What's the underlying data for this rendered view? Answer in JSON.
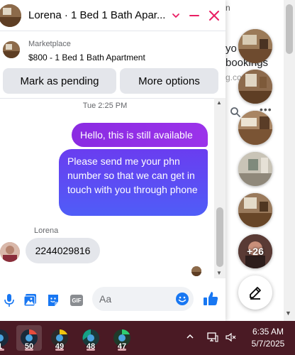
{
  "colors": {
    "accent": "#e91e63",
    "outgoing_bubble": "#7b3ff2",
    "incoming_bubble": "#e4e6eb",
    "action_button": "#e4e6eb",
    "link_blue": "#1877f2",
    "taskbar": "#4a1a24"
  },
  "background_page": {
    "fragments": [
      "n",
      "yo",
      "bookings",
      "g.co"
    ]
  },
  "chat_window": {
    "header": {
      "title": "Lorena · 1 Bed 1 Bath Apar...",
      "icons": [
        "chevron-down-icon",
        "minimize-icon",
        "close-icon"
      ]
    },
    "listing": {
      "source": "Marketplace",
      "title": "$800 - 1 Bed 1 Bath Apartment"
    },
    "actions": {
      "mark_pending": "Mark as pending",
      "more_options": "More options"
    },
    "thread": {
      "timestamp": "Tue 2:25 PM",
      "messages": [
        {
          "direction": "outgoing",
          "text": "Hello, this is still available"
        },
        {
          "direction": "outgoing",
          "text": "Please send me your phn number so that we can get in touch with you through phone"
        },
        {
          "direction": "incoming",
          "sender": "Lorena",
          "text": "2244029816"
        }
      ]
    },
    "composer": {
      "placeholder": "Aa",
      "gif_label": "GIF",
      "icons": [
        "microphone-icon",
        "photo-icon",
        "sticker-icon",
        "gif-icon",
        "emoji-icon",
        "thumbs-up-icon"
      ]
    }
  },
  "chat_heads": {
    "more_count": "+26",
    "compose_icon": "new-message-icon"
  },
  "taskbar": {
    "apps": [
      {
        "badge": "1"
      },
      {
        "badge": "50"
      },
      {
        "badge": "49"
      },
      {
        "badge": "48"
      },
      {
        "badge": "47"
      }
    ],
    "time": "6:35 AM",
    "date": "5/7/2025"
  }
}
